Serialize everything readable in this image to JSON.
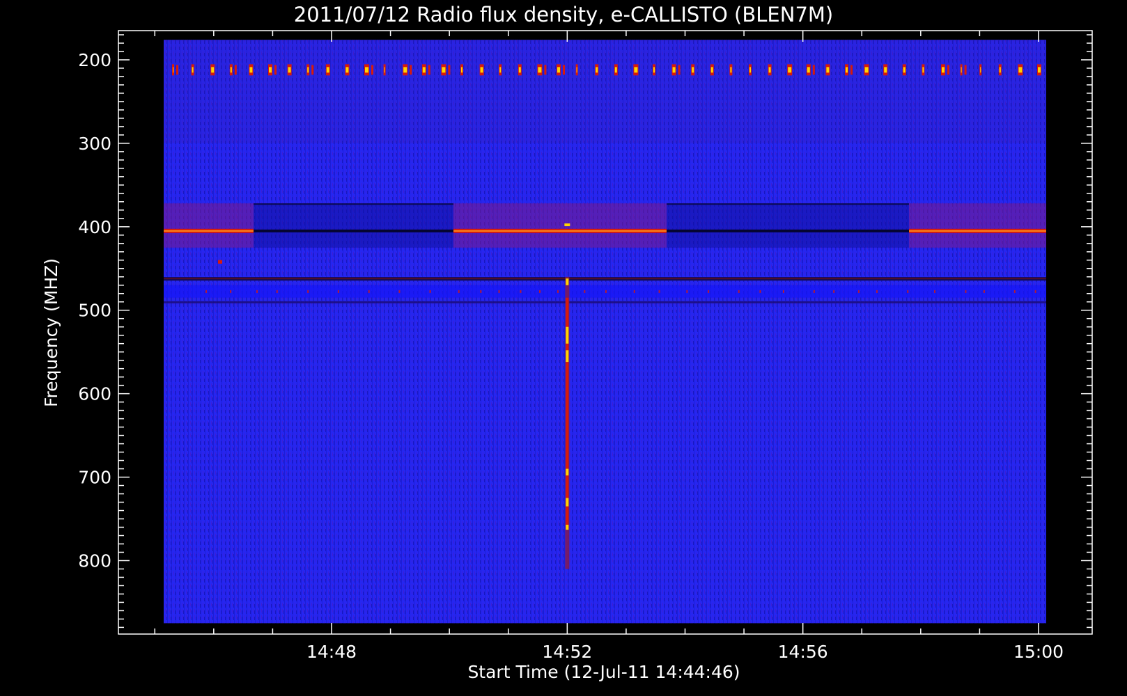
{
  "chart_data": {
    "type": "heatmap",
    "title": "2011/07/12  Radio flux density, e-CALLISTO (BLEN7M)",
    "xlabel": "Start Time (12-Jul-11 14:44:46)",
    "ylabel": "Frequency (MHZ)",
    "x_ticks": [
      "14:48",
      "14:52",
      "14:56",
      "15:00"
    ],
    "y_ticks": [
      "200",
      "300",
      "400",
      "500",
      "600",
      "700",
      "800"
    ],
    "y_tick_values": [
      200,
      300,
      400,
      500,
      600,
      700,
      800
    ],
    "ylim": [
      888,
      165
    ],
    "data_ylim": [
      875,
      176
    ],
    "grid": false,
    "colormap": "blue-red-yellow (spectrogram)",
    "colors": {
      "background": "#000000",
      "noise": "#2525f2",
      "band": "#d81b0a",
      "peak": "#ffd400",
      "axes": "#ffffff"
    },
    "features": [
      {
        "name": "interference band",
        "frequency_mhz": 405,
        "time_start": "14:44:46",
        "time_end": "15:00:00",
        "intermittent": true
      },
      {
        "name": "periodic pulses",
        "frequency_mhz": 212,
        "time_start": "14:44:46",
        "time_end": "15:00:00"
      },
      {
        "name": "narrowband burst",
        "time": "14:52:00",
        "frequency_range_mhz": [
          460,
          810
        ]
      },
      {
        "name": "horizontal line",
        "frequency_mhz": 462,
        "time_start": "14:44:46",
        "time_end": "15:00:00"
      }
    ]
  }
}
